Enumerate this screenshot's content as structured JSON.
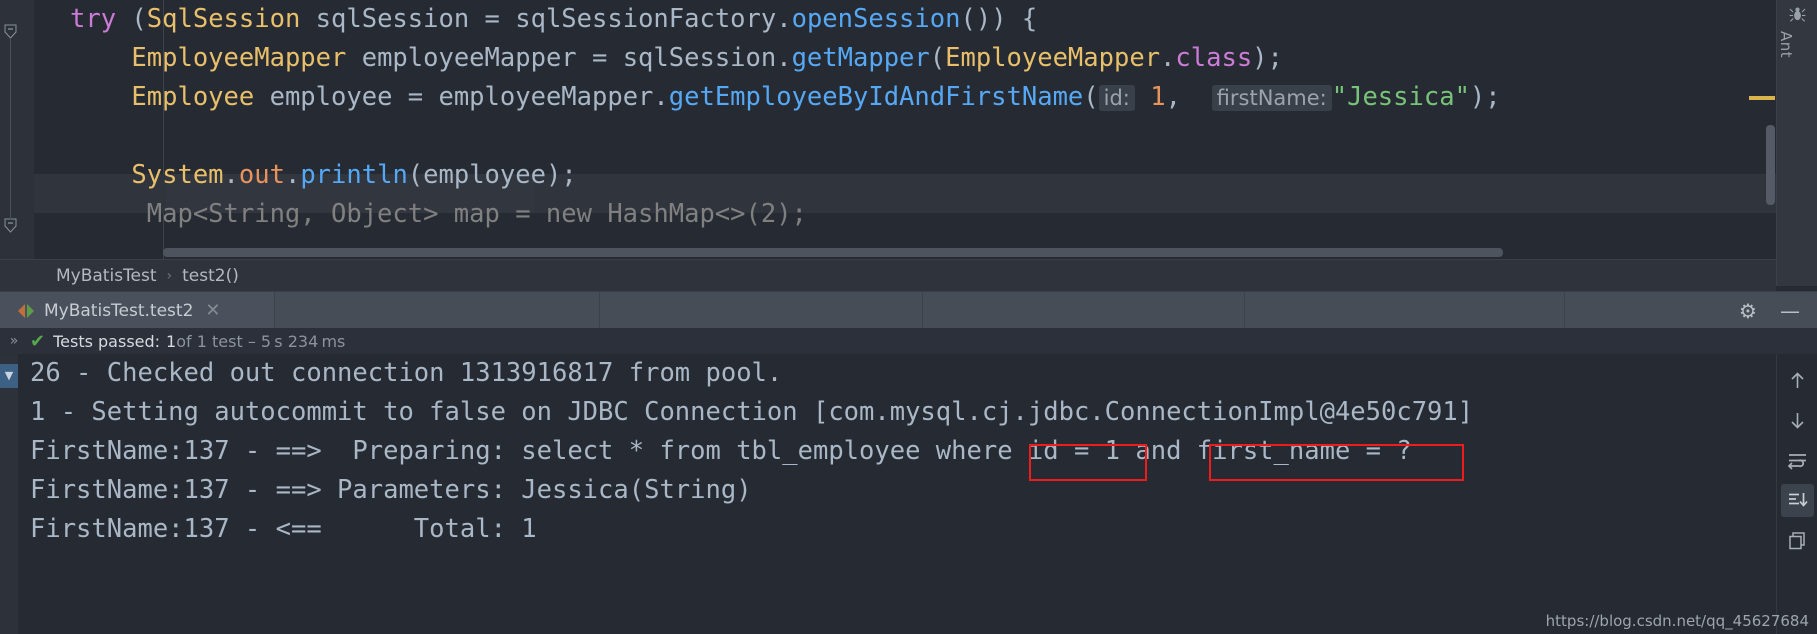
{
  "editor": {
    "lines": [
      {
        "id": "line-try",
        "fold": true,
        "segments": [
          {
            "t": "try",
            "c": "kw"
          },
          {
            "t": " (",
            "c": "plain"
          },
          {
            "t": "SqlSession",
            "c": "type"
          },
          {
            "t": " sqlSession = sqlSessionFactory.",
            "c": "plain"
          },
          {
            "t": "openSession",
            "c": "mth"
          },
          {
            "t": "()) {",
            "c": "plain"
          }
        ]
      },
      {
        "id": "line-mapper",
        "segments": [
          {
            "t": "    ",
            "c": "plain"
          },
          {
            "t": "EmployeeMapper",
            "c": "type"
          },
          {
            "t": " employeeMapper = sqlSession.",
            "c": "plain"
          },
          {
            "t": "getMapper",
            "c": "mth"
          },
          {
            "t": "(",
            "c": "plain"
          },
          {
            "t": "EmployeeMapper",
            "c": "type"
          },
          {
            "t": ".",
            "c": "plain"
          },
          {
            "t": "class",
            "c": "kw"
          },
          {
            "t": ");",
            "c": "plain"
          }
        ]
      },
      {
        "id": "line-employee",
        "segments": [
          {
            "t": "    ",
            "c": "plain"
          },
          {
            "t": "Employee",
            "c": "type"
          },
          {
            "t": " employee = employeeMapper.",
            "c": "plain"
          },
          {
            "t": "getEmployeeByIdAndFirstName",
            "c": "mth"
          },
          {
            "t": "(",
            "c": "plain"
          },
          {
            "t": "id:",
            "c": "hint"
          },
          {
            "t": " ",
            "c": "plain"
          },
          {
            "t": "1",
            "c": "num"
          },
          {
            "t": ",  ",
            "c": "plain"
          },
          {
            "t": "firstName:",
            "c": "hint"
          },
          {
            "t": "",
            "c": "plain"
          },
          {
            "t": "\"Jessica\"",
            "c": "str"
          },
          {
            "t": ");",
            "c": "plain"
          }
        ]
      },
      {
        "id": "line-blank",
        "segments": []
      },
      {
        "id": "line-println",
        "highlight": true,
        "segments": [
          {
            "t": "    ",
            "c": "plain"
          },
          {
            "t": "System",
            "c": "type"
          },
          {
            "t": ".",
            "c": "plain"
          },
          {
            "t": "out",
            "c": "num"
          },
          {
            "t": ".",
            "c": "plain"
          },
          {
            "t": "println",
            "c": "mth"
          },
          {
            "t": "(employee);",
            "c": "plain"
          }
        ]
      },
      {
        "id": "line-map",
        "fold": true,
        "segments": [
          {
            "t": "     Map<String, Object> map = new HashMap<>(2);",
            "c": "dim"
          }
        ]
      }
    ]
  },
  "right_strip": {
    "bug_icon": "ant-bug-icon",
    "label": "Ant"
  },
  "breadcrumb": {
    "class_name": "MyBatisTest",
    "separator": "›",
    "method_name": "test2()"
  },
  "run_tab": {
    "label": "MyBatisTest.test2",
    "close_glyph": "✕",
    "gear_glyph": "⚙",
    "minimize_glyph": "—"
  },
  "status": {
    "chevrons": "»",
    "check_glyph": "✔",
    "passed_label": "Tests passed:",
    "count": "1",
    "of_text": " of 1 test – 5 s 234 ms"
  },
  "console": {
    "collapse_glyph": "▼",
    "lines": [
      "26 - Checked out connection 1313916817 from pool.",
      "1 - Setting autocommit to false on JDBC Connection [com.mysql.cj.jdbc.ConnectionImpl@4e50c791]",
      "FirstName:137 - ==>  Preparing: select * from tbl_employee where id = 1 and first_name = ?",
      "FirstName:137 - ==> Parameters: Jessica(String)",
      "FirstName:137 - <==      Total: 1"
    ],
    "highlights": [
      {
        "name": "sql-condition-id",
        "label": "id = 1"
      },
      {
        "name": "sql-condition-first-name",
        "label": "first_name = ?"
      }
    ],
    "tools": [
      {
        "name": "scroll-up-icon",
        "glyph": "↑",
        "active": false
      },
      {
        "name": "scroll-down-icon",
        "glyph": "↓",
        "active": false
      },
      {
        "name": "soft-wrap-icon",
        "glyph": "",
        "active": false
      },
      {
        "name": "scroll-to-end-icon",
        "glyph": "",
        "active": true
      },
      {
        "name": "print-icon",
        "glyph": "",
        "active": false
      }
    ]
  },
  "watermark": "https://blog.csdn.net/qq_45627684",
  "colors": {
    "editor_bg": "#262b33",
    "gutter_bg": "#2c313a",
    "tabbar_bg": "#474d57",
    "accent_blue": "#5a8fd6",
    "pass_green": "#57a64a",
    "highlight_red": "#f01c1c"
  }
}
